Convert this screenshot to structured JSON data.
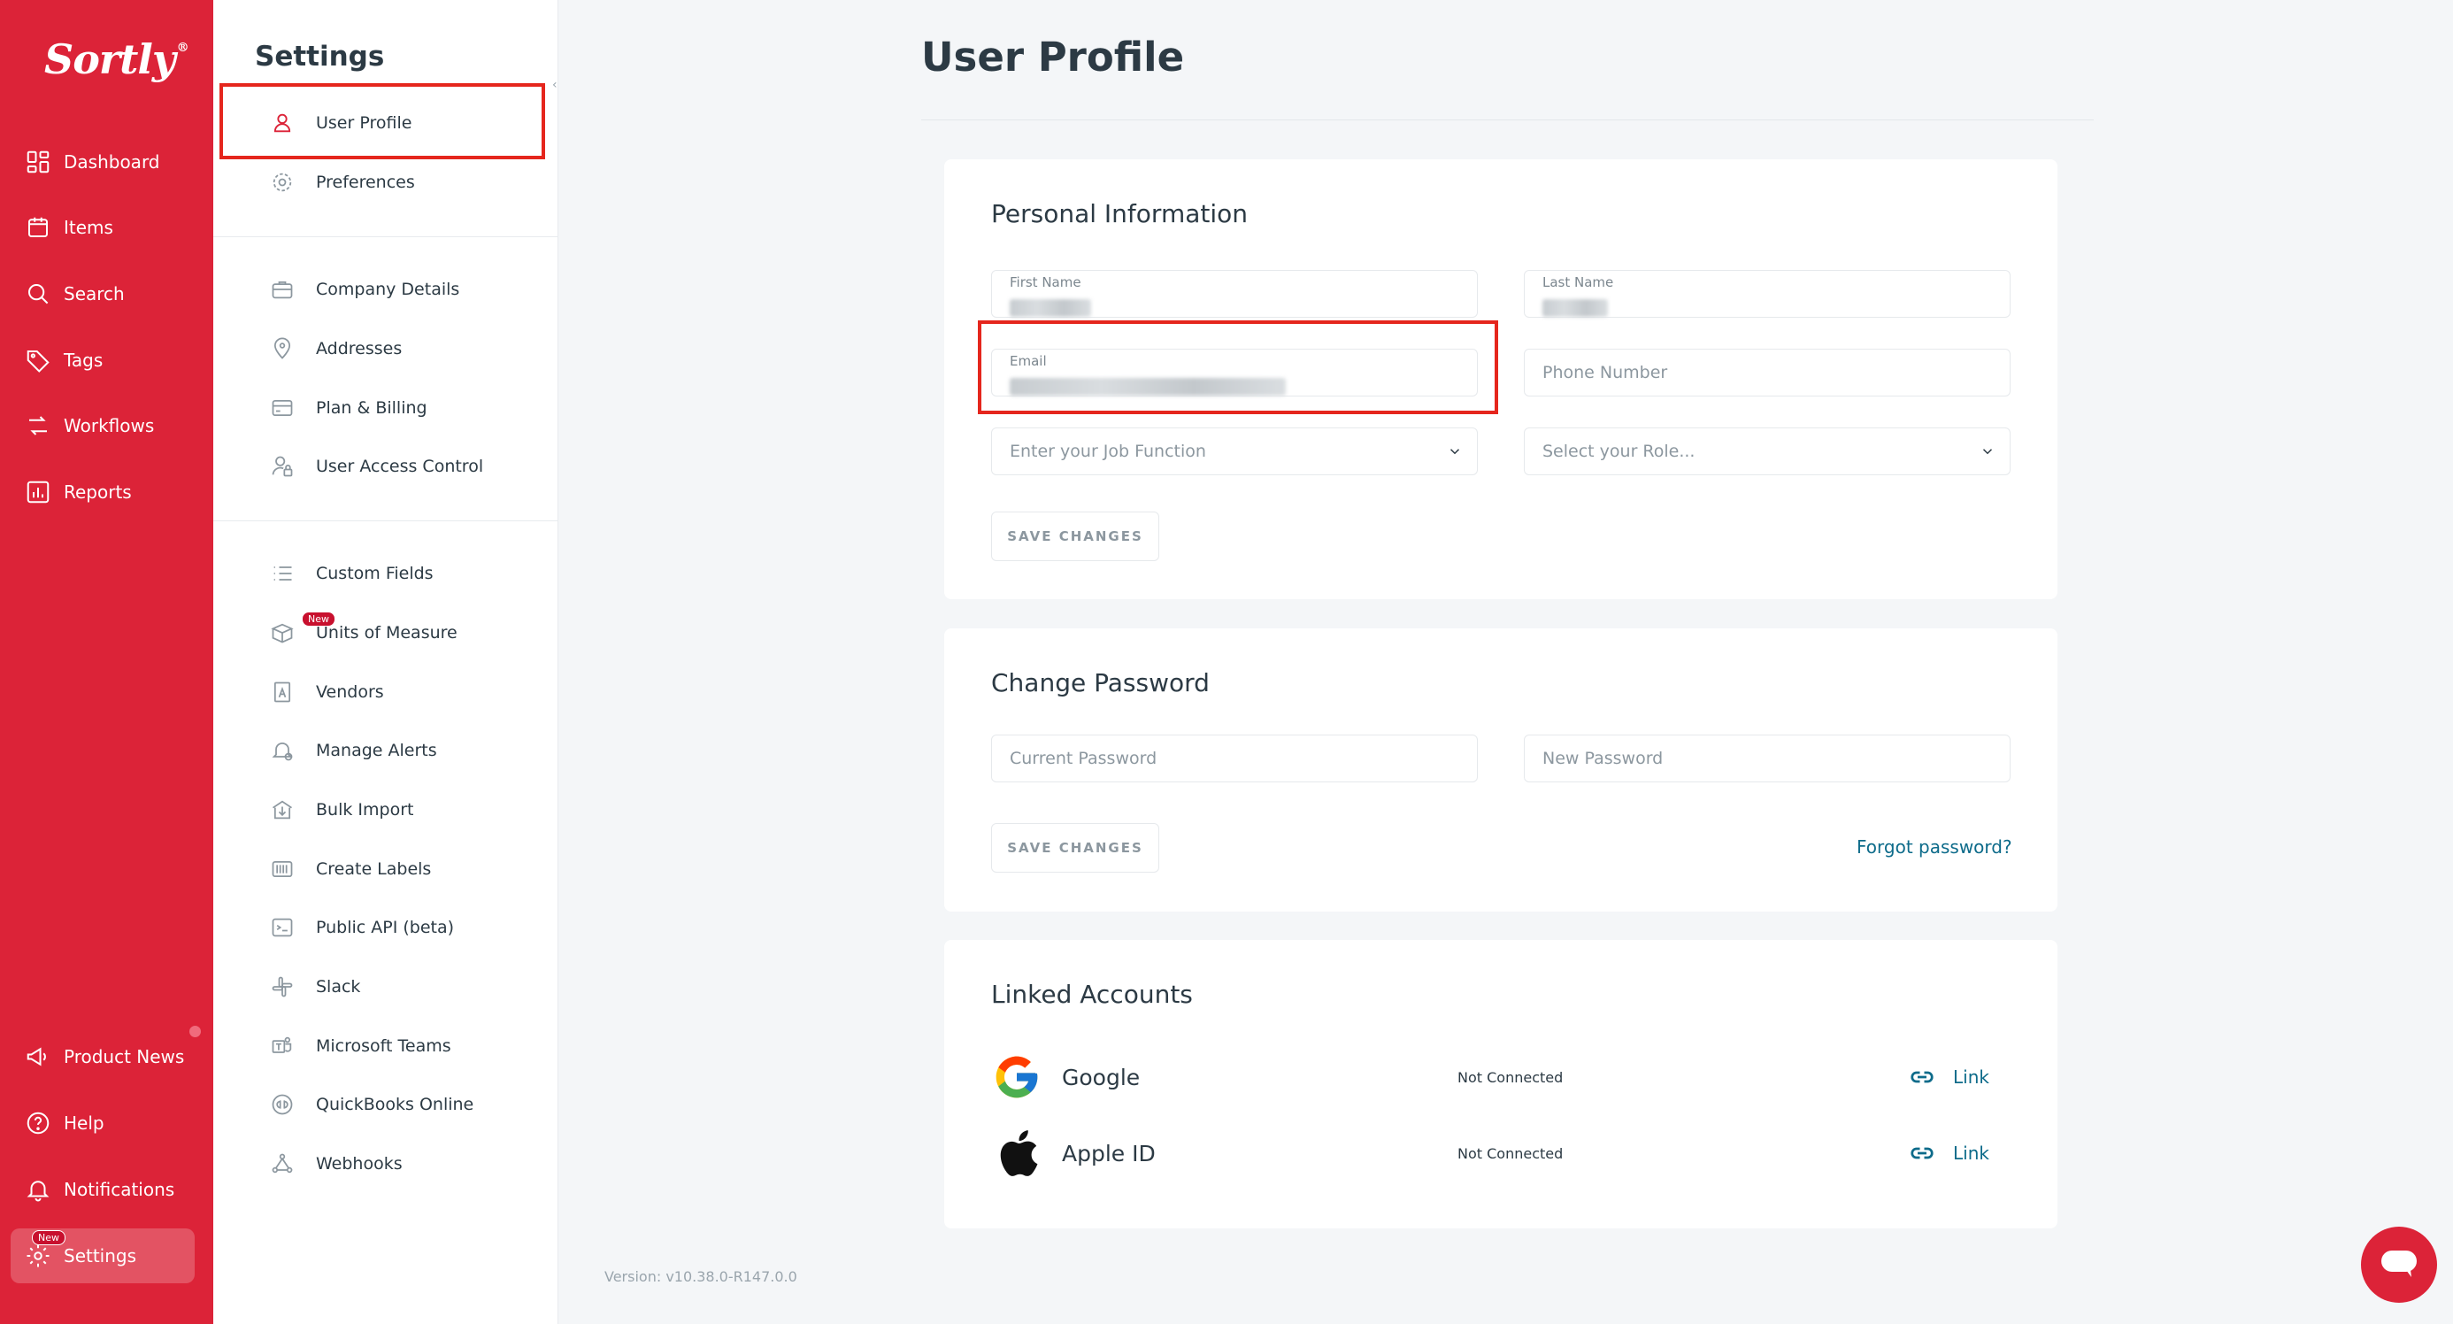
{
  "app": {
    "logo": "Sortly",
    "logo_mark": "®",
    "version": "Version: v10.38.0-R147.0.0"
  },
  "rail": {
    "items": [
      {
        "label": "Dashboard",
        "icon": "dashboard-icon"
      },
      {
        "label": "Items",
        "icon": "folder-icon"
      },
      {
        "label": "Search",
        "icon": "search-icon"
      },
      {
        "label": "Tags",
        "icon": "tag-icon"
      },
      {
        "label": "Workflows",
        "icon": "workflow-icon"
      },
      {
        "label": "Reports",
        "icon": "reports-icon"
      }
    ],
    "bottom": [
      {
        "label": "Product News",
        "icon": "megaphone-icon"
      },
      {
        "label": "Help",
        "icon": "help-icon"
      },
      {
        "label": "Notifications",
        "icon": "bell-icon"
      },
      {
        "label": "Settings",
        "icon": "gear-icon",
        "badge": "New"
      }
    ]
  },
  "settings": {
    "title": "Settings",
    "items": [
      {
        "label": "User Profile",
        "icon": "user-icon",
        "active": true
      },
      {
        "label": "Preferences",
        "icon": "gear-icon"
      },
      {
        "label": "Company Details",
        "icon": "briefcase-icon"
      },
      {
        "label": "Addresses",
        "icon": "location-pin-icon"
      },
      {
        "label": "Plan & Billing",
        "icon": "credit-card-icon"
      },
      {
        "label": "User Access Control",
        "icon": "user-lock-icon"
      },
      {
        "label": "Custom Fields",
        "icon": "list-icon"
      },
      {
        "label": "Units of Measure",
        "icon": "box-icon",
        "badge": "New"
      },
      {
        "label": "Vendors",
        "icon": "vendor-icon"
      },
      {
        "label": "Manage Alerts",
        "icon": "bell-icon"
      },
      {
        "label": "Bulk Import",
        "icon": "import-icon"
      },
      {
        "label": "Create Labels",
        "icon": "barcode-icon"
      },
      {
        "label": "Public API (beta)",
        "icon": "terminal-icon"
      },
      {
        "label": "Slack",
        "icon": "slack-icon"
      },
      {
        "label": "Microsoft Teams",
        "icon": "teams-icon"
      },
      {
        "label": "QuickBooks Online",
        "icon": "quickbooks-icon"
      },
      {
        "label": "Webhooks",
        "icon": "webhook-icon"
      }
    ]
  },
  "main": {
    "title": "User Profile",
    "personal": {
      "title": "Personal Information",
      "first_name_label": "First Name",
      "last_name_label": "Last Name",
      "email_label": "Email",
      "phone_placeholder": "Phone Number",
      "job_function_placeholder": "Enter your Job Function",
      "role_placeholder": "Select your Role...",
      "save_label": "SAVE CHANGES"
    },
    "password": {
      "title": "Change Password",
      "current_placeholder": "Current Password",
      "new_placeholder": "New Password",
      "save_label": "SAVE CHANGES",
      "forgot_label": "Forgot password?"
    },
    "linked": {
      "title": "Linked Accounts",
      "accounts": [
        {
          "name": "Google",
          "status": "Not Connected",
          "action": "Link",
          "icon": "google-icon"
        },
        {
          "name": "Apple ID",
          "status": "Not Connected",
          "action": "Link",
          "icon": "apple-icon"
        }
      ]
    }
  },
  "colors": {
    "brand": "#dc2338",
    "link": "#0d6b8a",
    "annotation": "#e5261d"
  }
}
